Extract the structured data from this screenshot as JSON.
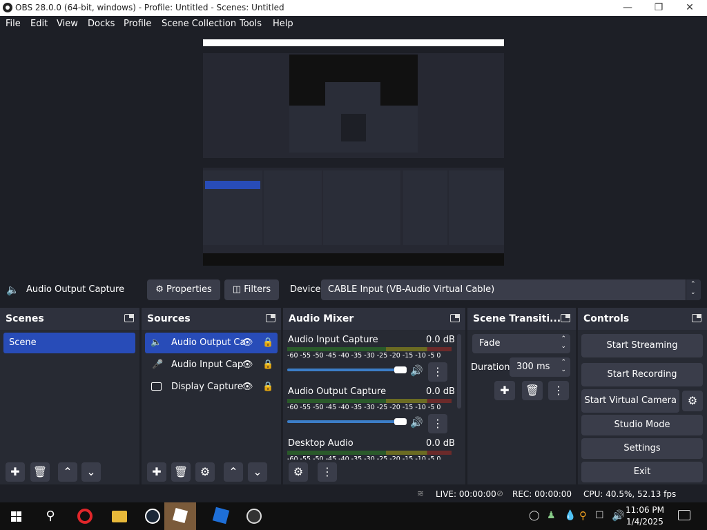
{
  "window": {
    "title": "OBS 28.0.0 (64-bit, windows) - Profile: Untitled - Scenes: Untitled",
    "minimize_icon": "minimize-icon",
    "maximize_icon": "restore-icon",
    "close_icon": "close-icon"
  },
  "menu": [
    "File",
    "Edit",
    "View",
    "Docks",
    "Profile",
    "Scene Collection",
    "Tools",
    "Help"
  ],
  "source_toolbar": {
    "source_name": "Audio Output Capture",
    "properties_label": "Properties",
    "filters_label": "Filters",
    "device_label": "Device",
    "device_value": "CABLE Input (VB-Audio Virtual Cable)"
  },
  "scenes": {
    "title": "Scenes",
    "items": [
      {
        "label": "Scene",
        "selected": true
      }
    ]
  },
  "sources": {
    "title": "Sources",
    "items": [
      {
        "label": "Audio Output Ca",
        "icon": "speaker-icon",
        "selected": true
      },
      {
        "label": "Audio Input Cap",
        "icon": "microphone-icon",
        "selected": false
      },
      {
        "label": "Display Capture",
        "icon": "monitor-icon",
        "selected": false
      }
    ]
  },
  "mixer": {
    "title": "Audio Mixer",
    "scale": "-60 -55 -50 -45 -40 -35 -30 -25 -20 -15 -10 -5 0",
    "channels": [
      {
        "name": "Audio Input Capture",
        "level": "0.0 dB",
        "volume": 1.0
      },
      {
        "name": "Audio Output Capture",
        "level": "0.0 dB",
        "volume": 1.0
      },
      {
        "name": "Desktop Audio",
        "level": "0.0 dB",
        "volume": 1.0
      }
    ]
  },
  "transitions": {
    "title": "Scene Transiti...",
    "selected": "Fade",
    "duration_label": "Duration",
    "duration_value": "300 ms"
  },
  "controls": {
    "title": "Controls",
    "start_streaming": "Start Streaming",
    "start_recording": "Start Recording",
    "start_virtual_camera": "Start Virtual Camera",
    "studio_mode": "Studio Mode",
    "settings": "Settings",
    "exit": "Exit"
  },
  "status": {
    "live": "LIVE: 00:00:00",
    "rec": "REC: 00:00:00",
    "cpu": "CPU: 40.5%, 52.13 fps"
  },
  "taskbar": {
    "time": "11:06 PM",
    "date": "1/4/2025",
    "apps": [
      "windows-start-icon",
      "search-icon",
      "opera-icon",
      "file-explorer-icon",
      "steam-icon",
      "roblox-studio-icon",
      "roblox-icon",
      "obs-icon"
    ]
  },
  "colors": {
    "bg": "#1d1f26",
    "panel": "#272a33",
    "selection": "#284cb8",
    "button": "#3a3d4a"
  }
}
